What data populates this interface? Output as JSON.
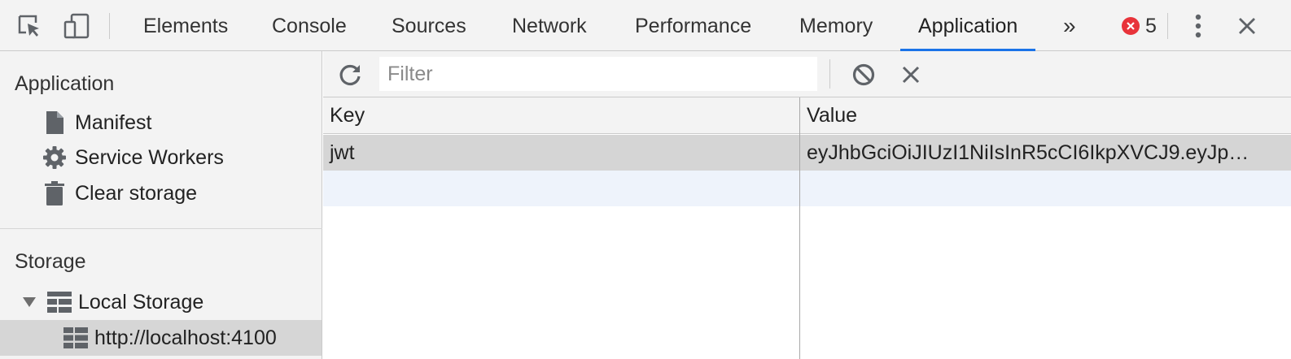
{
  "topbar": {
    "tabs": [
      {
        "label": "Elements"
      },
      {
        "label": "Console"
      },
      {
        "label": "Sources"
      },
      {
        "label": "Network"
      },
      {
        "label": "Performance"
      },
      {
        "label": "Memory"
      },
      {
        "label": "Application",
        "active": true
      }
    ],
    "more_label": "»",
    "error_count": "5",
    "accent_color": "#1a73e8",
    "error_color": "#e8333a"
  },
  "sidebar": {
    "application_title": "Application",
    "application_items": [
      {
        "label": "Manifest",
        "icon": "document-icon"
      },
      {
        "label": "Service Workers",
        "icon": "gear-icon"
      },
      {
        "label": "Clear storage",
        "icon": "trash-icon"
      }
    ],
    "storage_title": "Storage",
    "local_storage": {
      "label": "Local Storage",
      "icon": "table-icon",
      "expanded": true,
      "children": [
        {
          "label": "http://localhost:4100",
          "icon": "table-icon",
          "selected": true
        }
      ]
    }
  },
  "toolbar": {
    "filter_placeholder": "Filter",
    "filter_value": ""
  },
  "grid": {
    "columns": [
      "Key",
      "Value"
    ],
    "rows": [
      {
        "key": "jwt",
        "value": "eyJhbGciOiJIUzI1NiIsInR5cCI6IkpXVCJ9.eyJp…",
        "selected": true
      }
    ]
  }
}
